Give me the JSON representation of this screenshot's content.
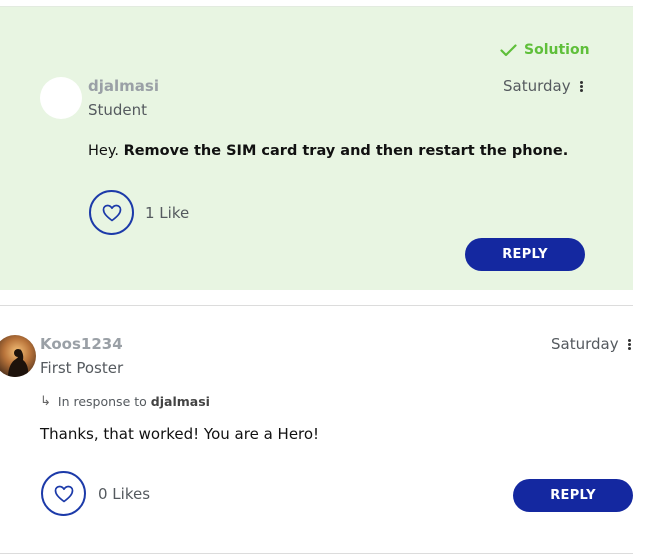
{
  "solution_post": {
    "badge_label": "Solution",
    "author": "djalmasi",
    "rank": "Student",
    "date": "Saturday",
    "body_prefix": "Hey. ",
    "body_bold": "Remove the SIM card tray and then restart the phone.",
    "like_count_label": "1 Like",
    "reply_label": "REPLY"
  },
  "reply_post": {
    "author": "Koos1234",
    "rank": "First Poster",
    "date": "Saturday",
    "in_response_to_label": "In response to",
    "in_response_to_user": "djalmasi",
    "body": "Thanks, that worked! You are a Hero!",
    "like_count_label": "0 Likes",
    "reply_label": "REPLY"
  },
  "colors": {
    "solution_bg": "#e8f5e2",
    "solution_green": "#5fbf3a",
    "brand_blue": "#1428a0",
    "like_ring": "#1c3aa9"
  },
  "icons": {
    "solution": "checkmark-icon",
    "like": "heart-icon",
    "menu": "kebab-menu-icon",
    "response": "reply-arrow-icon"
  }
}
